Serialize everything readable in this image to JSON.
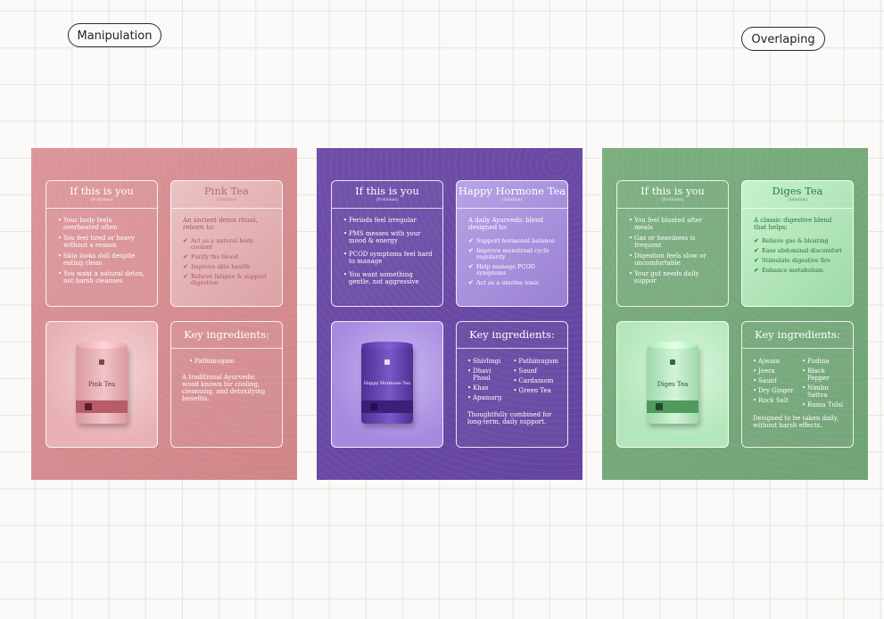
{
  "labels": {
    "left": "Manipulation",
    "right": "Overlaping"
  },
  "colors": {
    "pink_bg": "#d4898d",
    "purple_bg": "#6a4aa4",
    "green_bg": "#77a97c"
  },
  "boards": [
    {
      "problems": {
        "title": "If this is you",
        "subtitle": "(Problems)",
        "items": [
          "Your body feels overheated often",
          "You feel tired or heavy without a reason",
          "Skin looks dull despite eating clean",
          "You want a natural detox, not harsh cleanses"
        ]
      },
      "solution": {
        "title": "Pink Tea",
        "subtitle": "(Solution)",
        "intro": "An ancient detox ritual, reborn to:",
        "items": [
          "Act as a natural body coolant",
          "Purify the blood",
          "Improve skin health",
          "Relieve fatigue & support digestion"
        ]
      },
      "product": {
        "label": "Pink Tea"
      },
      "ingredients": {
        "title": "Key ingredients:",
        "col1": [
          "Pathimugam"
        ],
        "col2": [],
        "note": "A traditional Ayurvedic wood known for cooling, cleansing, and detoxifying benefits."
      }
    },
    {
      "problems": {
        "title": "If this is you",
        "subtitle": "(Problems)",
        "items": [
          "Periods feel irregular",
          "PMS messes with your mood & energy",
          "PCOD symptoms feel hard to manage",
          "You want something gentle, not aggressive"
        ]
      },
      "solution": {
        "title": "Happy Hormone Tea",
        "subtitle": "(Solution)",
        "intro": "A daily Ayurvedic blend designed to:",
        "items": [
          "Support hormonal balance",
          "Improve menstrual cycle regularity",
          "Help manage PCOD symptoms",
          "Act as a uterine tonic"
        ]
      },
      "product": {
        "label": "Happy Hormone Tea"
      },
      "ingredients": {
        "title": "Key ingredients:",
        "col1": [
          "Shivlingi",
          "Dhavi Phool",
          "Khas",
          "Apamarg"
        ],
        "col2": [
          "Pathimugam",
          "Saunf",
          "Cardamom",
          "Green Tea"
        ],
        "note": "Thoughtfully combined for long-term, daily support."
      }
    },
    {
      "problems": {
        "title": "If this is you",
        "subtitle": "(Problems)",
        "items": [
          "You feel bloated after meals",
          "Gas or heaviness is frequent",
          "Digestion feels slow or uncomfortable",
          "Your gut needs daily suppor"
        ]
      },
      "solution": {
        "title": "Diges Tea",
        "subtitle": "(Solution)",
        "intro": "A classic digestive blend that helps:",
        "items": [
          "Relieve gas & bloating",
          "Ease abdominal discomfort",
          "Stimulate digestive fire",
          "Enhance metabolism"
        ]
      },
      "product": {
        "label": "Diges Tea"
      },
      "ingredients": {
        "title": "Key ingredients:",
        "col1": [
          "Ajwain",
          "Jeera",
          "Saunf",
          "Dry Ginger",
          "Rock Salt"
        ],
        "col2": [
          "Pudina",
          "Black Pepper",
          "Nimbu Sattva",
          "Ruma Tulsi"
        ],
        "note": "Designed to be taken daily, without harsh effects."
      }
    }
  ]
}
